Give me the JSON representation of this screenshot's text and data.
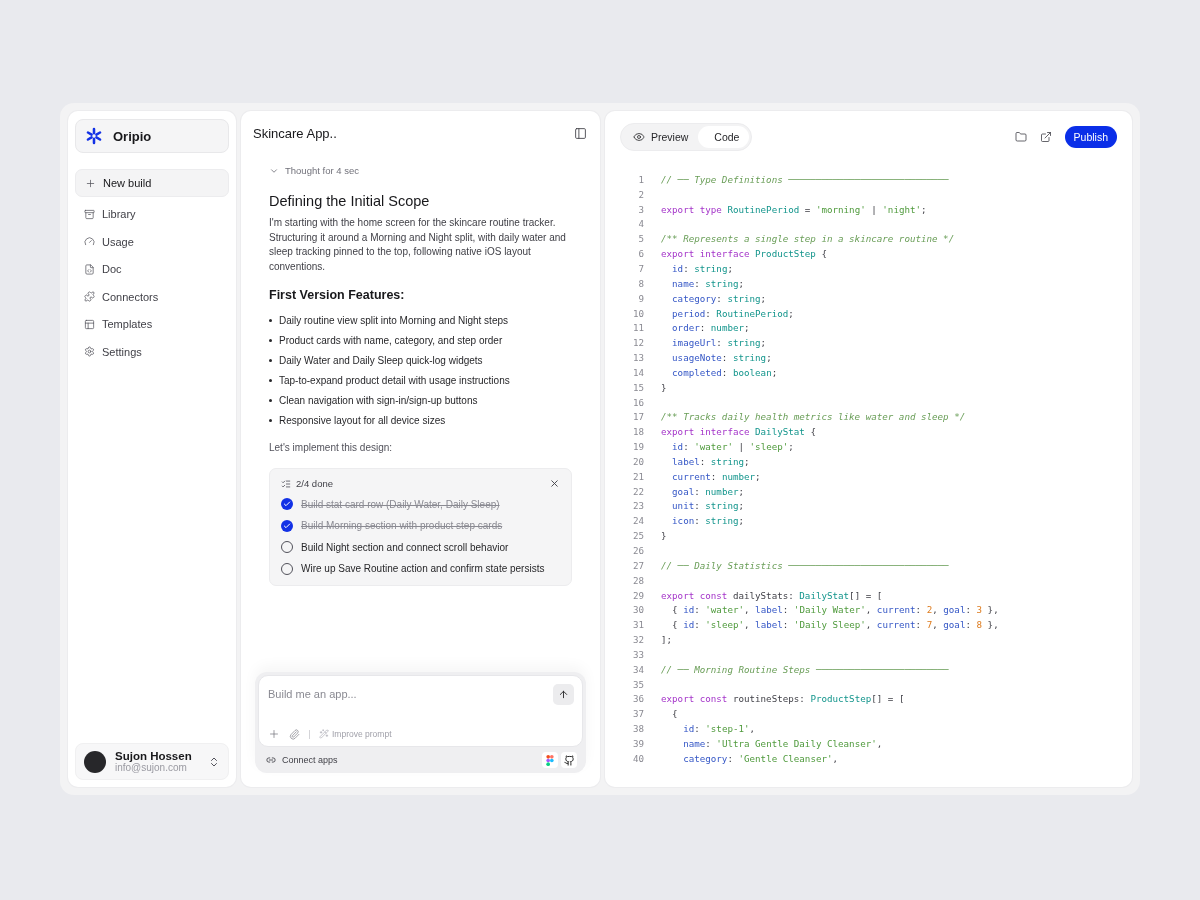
{
  "sidebar": {
    "brand": "Oripio",
    "items": [
      {
        "label": "New build",
        "selected": true
      },
      {
        "label": "Library",
        "selected": false
      },
      {
        "label": "Usage",
        "selected": false
      },
      {
        "label": "Doc",
        "selected": false
      },
      {
        "label": "Connectors",
        "selected": false
      },
      {
        "label": "Templates",
        "selected": false
      },
      {
        "label": "Settings",
        "selected": false
      }
    ],
    "user": {
      "name": "Sujon Hossen",
      "email": "info@sujon.com"
    }
  },
  "chat": {
    "title": "Skincare App..",
    "thought": {
      "label": "Thought for 4 sec",
      "expanded": true
    },
    "heading": "Defining the Initial Scope",
    "paragraph": "I'm starting with the home screen for the skincare routine tracker. Structuring it around a Morning and Night split, with daily water and sleep tracking pinned to the top, following native iOS layout conventions.",
    "subheading": "First Version Features:",
    "bullets": [
      "Daily routine view split into Morning and Night steps",
      "Product cards with name, category, and step order",
      "Daily Water and Daily Sleep quick-log widgets",
      "Tap-to-expand product detail with usage instructions",
      "Clean navigation with sign-in/sign-up buttons",
      "Responsive layout for all device sizes"
    ],
    "lead": "Let's implement this design:",
    "tasks": {
      "progress": "2/4 done",
      "items": [
        {
          "label": "Build stat card row (Daily Water, Daily Sleep)",
          "checked": true
        },
        {
          "label": "Build Morning section with product step cards",
          "checked": true
        },
        {
          "label": "Build Night section and connect scroll behavior",
          "checked": false
        },
        {
          "label": "Wire up Save Routine action and confirm state persists",
          "checked": false
        }
      ]
    },
    "composer": {
      "placeholder": "Build me an app...",
      "improve": "Improve prompt",
      "connect": "Connect apps"
    }
  },
  "editor": {
    "tabs": [
      {
        "label": "Preview",
        "selected": false
      },
      {
        "label": "Code",
        "selected": true
      }
    ],
    "publish": "Publish",
    "lines": [
      {
        "number": "1",
        "tokens": [
          {
            "kind": "comment",
            "text": "// ── Type Definitions ─────────────────────────────"
          }
        ]
      },
      {
        "number": "2"
      },
      {
        "number": "3",
        "tokens": [
          {
            "kind": "keyword",
            "text": "export type "
          },
          {
            "kind": "type",
            "text": "RoutinePeriod"
          },
          {
            "kind": "plain",
            "text": " = "
          },
          {
            "kind": "string",
            "text": "'morning'"
          },
          {
            "kind": "plain",
            "text": " | "
          },
          {
            "kind": "string",
            "text": "'night'"
          },
          {
            "kind": "plain",
            "text": ";"
          }
        ]
      },
      {
        "number": "4"
      },
      {
        "number": "5",
        "tokens": [
          {
            "kind": "comment",
            "text": "/** Represents a single step in a skincare routine */"
          }
        ]
      },
      {
        "number": "6",
        "tokens": [
          {
            "kind": "keyword",
            "text": "export interface "
          },
          {
            "kind": "type",
            "text": "ProductStep"
          },
          {
            "kind": "plain",
            "text": " {"
          }
        ]
      },
      {
        "number": "7",
        "tokens": [
          {
            "kind": "prop",
            "text": "  id"
          },
          {
            "kind": "plain",
            "text": ": "
          },
          {
            "kind": "type",
            "text": "string"
          },
          {
            "kind": "plain",
            "text": ";"
          }
        ]
      },
      {
        "number": "8",
        "tokens": [
          {
            "kind": "prop",
            "text": "  name"
          },
          {
            "kind": "plain",
            "text": ": "
          },
          {
            "kind": "type",
            "text": "string"
          },
          {
            "kind": "plain",
            "text": ";"
          }
        ]
      },
      {
        "number": "9",
        "tokens": [
          {
            "kind": "prop",
            "text": "  category"
          },
          {
            "kind": "plain",
            "text": ": "
          },
          {
            "kind": "type",
            "text": "string"
          },
          {
            "kind": "plain",
            "text": ";"
          }
        ]
      },
      {
        "number": "10",
        "tokens": [
          {
            "kind": "prop",
            "text": "  period"
          },
          {
            "kind": "plain",
            "text": ": "
          },
          {
            "kind": "type",
            "text": "RoutinePeriod"
          },
          {
            "kind": "plain",
            "text": ";"
          }
        ]
      },
      {
        "number": "11",
        "tokens": [
          {
            "kind": "prop",
            "text": "  order"
          },
          {
            "kind": "plain",
            "text": ": "
          },
          {
            "kind": "type",
            "text": "number"
          },
          {
            "kind": "plain",
            "text": ";"
          }
        ]
      },
      {
        "number": "12",
        "tokens": [
          {
            "kind": "prop",
            "text": "  imageUrl"
          },
          {
            "kind": "plain",
            "text": ": "
          },
          {
            "kind": "type",
            "text": "string"
          },
          {
            "kind": "plain",
            "text": ";"
          }
        ]
      },
      {
        "number": "13",
        "tokens": [
          {
            "kind": "prop",
            "text": "  usageNote"
          },
          {
            "kind": "plain",
            "text": ": "
          },
          {
            "kind": "type",
            "text": "string"
          },
          {
            "kind": "plain",
            "text": ";"
          }
        ]
      },
      {
        "number": "14",
        "tokens": [
          {
            "kind": "prop",
            "text": "  completed"
          },
          {
            "kind": "plain",
            "text": ": "
          },
          {
            "kind": "type",
            "text": "boolean"
          },
          {
            "kind": "plain",
            "text": ";"
          }
        ]
      },
      {
        "number": "15",
        "tokens": [
          {
            "kind": "plain",
            "text": "}"
          }
        ]
      },
      {
        "number": "16"
      },
      {
        "number": "17",
        "tokens": [
          {
            "kind": "comment",
            "text": "/** Tracks daily health metrics like water and sleep */"
          }
        ]
      },
      {
        "number": "18",
        "tokens": [
          {
            "kind": "keyword",
            "text": "export interface "
          },
          {
            "kind": "type",
            "text": "DailyStat"
          },
          {
            "kind": "plain",
            "text": " {"
          }
        ]
      },
      {
        "number": "19",
        "tokens": [
          {
            "kind": "prop",
            "text": "  id"
          },
          {
            "kind": "plain",
            "text": ": "
          },
          {
            "kind": "string",
            "text": "'water'"
          },
          {
            "kind": "plain",
            "text": " | "
          },
          {
            "kind": "string",
            "text": "'sleep'"
          },
          {
            "kind": "plain",
            "text": ";"
          }
        ]
      },
      {
        "number": "20",
        "tokens": [
          {
            "kind": "prop",
            "text": "  label"
          },
          {
            "kind": "plain",
            "text": ": "
          },
          {
            "kind": "type",
            "text": "string"
          },
          {
            "kind": "plain",
            "text": ";"
          }
        ]
      },
      {
        "number": "21",
        "tokens": [
          {
            "kind": "prop",
            "text": "  current"
          },
          {
            "kind": "plain",
            "text": ": "
          },
          {
            "kind": "type",
            "text": "number"
          },
          {
            "kind": "plain",
            "text": ";"
          }
        ]
      },
      {
        "number": "22",
        "tokens": [
          {
            "kind": "prop",
            "text": "  goal"
          },
          {
            "kind": "plain",
            "text": ": "
          },
          {
            "kind": "type",
            "text": "number"
          },
          {
            "kind": "plain",
            "text": ";"
          }
        ]
      },
      {
        "number": "23",
        "tokens": [
          {
            "kind": "prop",
            "text": "  unit"
          },
          {
            "kind": "plain",
            "text": ": "
          },
          {
            "kind": "type",
            "text": "string"
          },
          {
            "kind": "plain",
            "text": ";"
          }
        ]
      },
      {
        "number": "24",
        "tokens": [
          {
            "kind": "prop",
            "text": "  icon"
          },
          {
            "kind": "plain",
            "text": ": "
          },
          {
            "kind": "type",
            "text": "string"
          },
          {
            "kind": "plain",
            "text": ";"
          }
        ]
      },
      {
        "number": "25",
        "tokens": [
          {
            "kind": "plain",
            "text": "}"
          }
        ]
      },
      {
        "number": "26"
      },
      {
        "number": "27",
        "tokens": [
          {
            "kind": "comment",
            "text": "// ── Daily Statistics ─────────────────────────────"
          }
        ]
      },
      {
        "number": "28"
      },
      {
        "number": "29",
        "tokens": [
          {
            "kind": "keyword",
            "text": "export const "
          },
          {
            "kind": "plain",
            "text": "dailyStats: "
          },
          {
            "kind": "type",
            "text": "DailyStat"
          },
          {
            "kind": "plain",
            "text": "[] = ["
          }
        ]
      },
      {
        "number": "30",
        "tokens": [
          {
            "kind": "plain",
            "text": "  { "
          },
          {
            "kind": "prop",
            "text": "id"
          },
          {
            "kind": "plain",
            "text": ": "
          },
          {
            "kind": "string",
            "text": "'water'"
          },
          {
            "kind": "plain",
            "text": ", "
          },
          {
            "kind": "prop",
            "text": "label"
          },
          {
            "kind": "plain",
            "text": ": "
          },
          {
            "kind": "string",
            "text": "'Daily Water'"
          },
          {
            "kind": "plain",
            "text": ", "
          },
          {
            "kind": "prop",
            "text": "current"
          },
          {
            "kind": "plain",
            "text": ": "
          },
          {
            "kind": "number",
            "text": "2"
          },
          {
            "kind": "plain",
            "text": ", "
          },
          {
            "kind": "prop",
            "text": "goal"
          },
          {
            "kind": "plain",
            "text": ": "
          },
          {
            "kind": "number",
            "text": "3"
          },
          {
            "kind": "plain",
            "text": " },"
          }
        ]
      },
      {
        "number": "31",
        "tokens": [
          {
            "kind": "plain",
            "text": "  { "
          },
          {
            "kind": "prop",
            "text": "id"
          },
          {
            "kind": "plain",
            "text": ": "
          },
          {
            "kind": "string",
            "text": "'sleep'"
          },
          {
            "kind": "plain",
            "text": ", "
          },
          {
            "kind": "prop",
            "text": "label"
          },
          {
            "kind": "plain",
            "text": ": "
          },
          {
            "kind": "string",
            "text": "'Daily Sleep'"
          },
          {
            "kind": "plain",
            "text": ", "
          },
          {
            "kind": "prop",
            "text": "current"
          },
          {
            "kind": "plain",
            "text": ": "
          },
          {
            "kind": "number",
            "text": "7"
          },
          {
            "kind": "plain",
            "text": ", "
          },
          {
            "kind": "prop",
            "text": "goal"
          },
          {
            "kind": "plain",
            "text": ": "
          },
          {
            "kind": "number",
            "text": "8"
          },
          {
            "kind": "plain",
            "text": " },"
          }
        ]
      },
      {
        "number": "32",
        "tokens": [
          {
            "kind": "plain",
            "text": "];"
          }
        ]
      },
      {
        "number": "33"
      },
      {
        "number": "34",
        "tokens": [
          {
            "kind": "comment",
            "text": "// ── Morning Routine Steps ────────────────────────"
          }
        ]
      },
      {
        "number": "35"
      },
      {
        "number": "36",
        "tokens": [
          {
            "kind": "keyword",
            "text": "export const "
          },
          {
            "kind": "plain",
            "text": "routineSteps: "
          },
          {
            "kind": "type",
            "text": "ProductStep"
          },
          {
            "kind": "plain",
            "text": "[] = ["
          }
        ]
      },
      {
        "number": "37",
        "tokens": [
          {
            "kind": "plain",
            "text": "  {"
          }
        ]
      },
      {
        "number": "38",
        "tokens": [
          {
            "kind": "prop",
            "text": "    id"
          },
          {
            "kind": "plain",
            "text": ": "
          },
          {
            "kind": "string",
            "text": "'step-1'"
          },
          {
            "kind": "plain",
            "text": ","
          }
        ]
      },
      {
        "number": "39",
        "tokens": [
          {
            "kind": "prop",
            "text": "    name"
          },
          {
            "kind": "plain",
            "text": ": "
          },
          {
            "kind": "string",
            "text": "'Ultra Gentle Daily Cleanser'"
          },
          {
            "kind": "plain",
            "text": ","
          }
        ]
      },
      {
        "number": "40",
        "tokens": [
          {
            "kind": "prop",
            "text": "    category"
          },
          {
            "kind": "plain",
            "text": ": "
          },
          {
            "kind": "string",
            "text": "'Gentle Cleanser'"
          },
          {
            "kind": "plain",
            "text": ","
          }
        ]
      }
    ]
  }
}
